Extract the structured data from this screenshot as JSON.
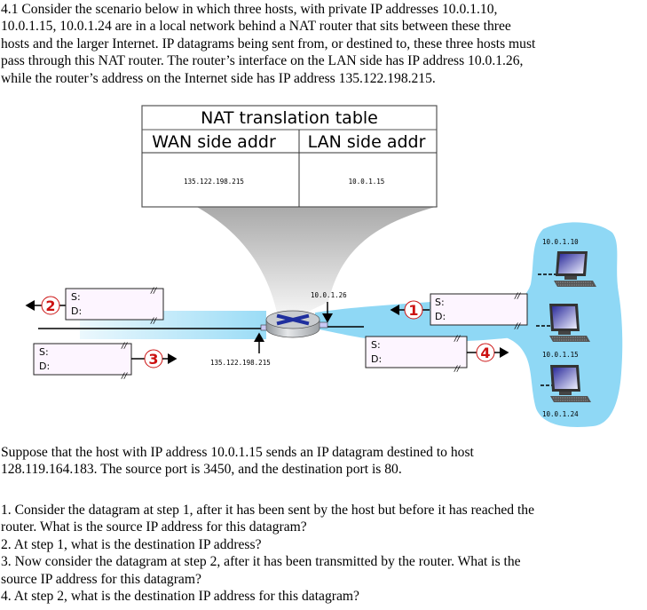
{
  "intro": {
    "lines": [
      "4.1 Consider the scenario below in which three hosts, with private IP addresses 10.0.1.10,",
      "10.0.1.15, 10.0.1.24 are in a local network behind a NAT router that sits between these three",
      "hosts and the larger Internet. IP datagrams being sent from, or destined to, these three hosts must",
      "pass through this NAT router. The router’s interface on the LAN side has IP address 10.0.1.26,",
      "while the router’s address on the Internet side has IP address 135.122.198.215."
    ]
  },
  "nat_table": {
    "title": "NAT translation table",
    "headers": [
      "WAN side addr",
      "LAN side addr"
    ],
    "rows": [
      [
        "135.122.198.215",
        "10.0.1.15"
      ]
    ]
  },
  "router": {
    "lan_ip": "10.0.1.26",
    "wan_ip": "135.122.198.215"
  },
  "hosts": [
    {
      "ip": "10.0.1.10"
    },
    {
      "ip": "10.0.1.15"
    },
    {
      "ip": "10.0.1.24"
    }
  ],
  "datagrams": [
    {
      "step": "1",
      "source_label": "S:",
      "dest_label": "D:"
    },
    {
      "step": "2",
      "source_label": "S:",
      "dest_label": "D:"
    },
    {
      "step": "3",
      "source_label": "S:",
      "dest_label": "D:"
    },
    {
      "step": "4",
      "source_label": "S:",
      "dest_label": "D:"
    }
  ],
  "colors": {
    "lan_cloud": "#8fd8f5",
    "step_circle": "#cc1111",
    "datagram_fill": "#fdf5ff",
    "router_cross": "#1f2f9e"
  },
  "scenario": {
    "lines": [
      "Suppose that the host with IP address 10.0.1.15 sends an IP datagram destined to host",
      "128.119.164.183. The source port is 3450, and the destination port is 80."
    ]
  },
  "questions": {
    "lines": [
      "1. Consider the datagram at step 1, after it has been sent by the host but before it has reached the",
      "router. What is the source IP address for this datagram?",
      "2. At step 1, what is the destination IP address?",
      "3. Now consider the datagram at step 2, after it has been transmitted by the router. What is the",
      "source IP address for this datagram?",
      "4. At step 2, what is the destination IP address for this datagram?"
    ]
  }
}
